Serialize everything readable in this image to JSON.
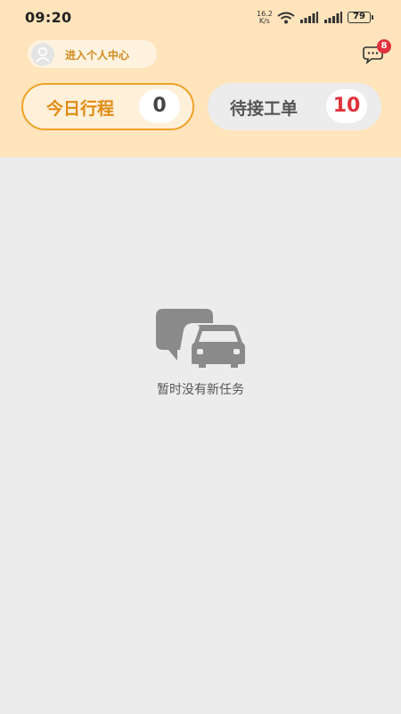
{
  "status_bar": {
    "time": "09:20",
    "net_speed_value": "16.2",
    "net_speed_unit": "K/s",
    "battery": "79"
  },
  "header": {
    "profile_label": "进入个人中心",
    "message_badge": "8",
    "background_color": "#ffe4bc",
    "accent_color": "#f0a226"
  },
  "tabs": [
    {
      "label": "今日行程",
      "count": "0",
      "selected": true
    },
    {
      "label": "待接工单",
      "count": "10",
      "selected": false
    }
  ],
  "empty_state": {
    "text": "暂时没有新任务",
    "icon": "car-chat-icon"
  }
}
